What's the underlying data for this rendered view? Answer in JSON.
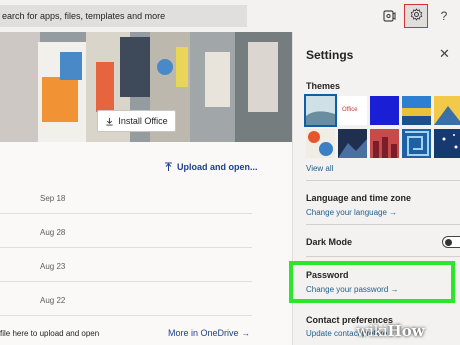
{
  "search": {
    "text": "earch for apps, files, templates and more"
  },
  "toolbar": {
    "chat_icon": "chat-icon",
    "settings_icon": "gear-icon",
    "help_label": "?"
  },
  "hero": {
    "install_label": "Install Office"
  },
  "upload": {
    "label": "Upload and open..."
  },
  "files": {
    "rows": [
      {
        "date": "Sep 18"
      },
      {
        "date": "Aug 28"
      },
      {
        "date": "Aug 23"
      },
      {
        "date": "Aug 22"
      }
    ],
    "drop_hint": "file here to upload and open",
    "more_link": "More in OneDrive →"
  },
  "settings": {
    "title": "Settings",
    "close_label": "✕",
    "themes": {
      "heading": "Themes",
      "office_label": "Office",
      "view_all": "View all"
    },
    "language": {
      "heading": "Language and time zone",
      "link": "Change your language →"
    },
    "dark_mode": {
      "heading": "Dark Mode",
      "enabled": false
    },
    "password": {
      "heading": "Password",
      "link": "Change your password →"
    },
    "contact": {
      "heading": "Contact preferences",
      "link": "Update contact prefere..."
    }
  },
  "colors": {
    "highlight": "#2ee52e",
    "link": "#1f5f8c",
    "selected_outline": "#0f5fa6"
  },
  "watermark": {
    "prefix": "wiki",
    "suffix": "How"
  }
}
